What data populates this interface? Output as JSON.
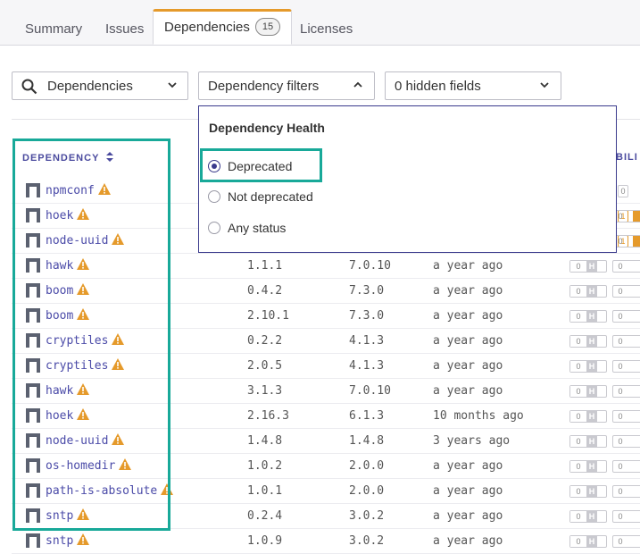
{
  "tabs": [
    {
      "label": "Summary"
    },
    {
      "label": "Issues"
    },
    {
      "label": "Dependencies",
      "count": "15"
    },
    {
      "label": "Licenses"
    }
  ],
  "toolbar": {
    "search_select": "Dependencies",
    "filters_select": "Dependency filters",
    "hidden_fields": "0 hidden fields"
  },
  "table": {
    "dependency_header": "DEPENDENCY",
    "right_header_partial": "BILI",
    "rows": [
      {
        "name": "npmconf",
        "version": "",
        "latest": "",
        "updated": "",
        "vuln": "0",
        "vuln_level": "",
        "vuln_alt": ""
      },
      {
        "name": "hoek",
        "version": "",
        "latest": "",
        "updated": "",
        "vuln": "1",
        "vuln_level": "",
        "vuln_alt": "0"
      },
      {
        "name": "node-uuid",
        "version": "",
        "latest": "",
        "updated": "",
        "vuln": "1",
        "vuln_level": "",
        "vuln_alt": "0"
      },
      {
        "name": "hawk",
        "version": "1.1.1",
        "latest": "7.0.10",
        "updated": "a year ago",
        "vuln": "0",
        "vuln_level": "H",
        "vuln_alt": "0"
      },
      {
        "name": "boom",
        "version": "0.4.2",
        "latest": "7.3.0",
        "updated": "a year ago",
        "vuln": "0",
        "vuln_level": "H",
        "vuln_alt": "0"
      },
      {
        "name": "boom",
        "version": "2.10.1",
        "latest": "7.3.0",
        "updated": "a year ago",
        "vuln": "0",
        "vuln_level": "H",
        "vuln_alt": "0"
      },
      {
        "name": "cryptiles",
        "version": "0.2.2",
        "latest": "4.1.3",
        "updated": "a year ago",
        "vuln": "0",
        "vuln_level": "H",
        "vuln_alt": "0"
      },
      {
        "name": "cryptiles",
        "version": "2.0.5",
        "latest": "4.1.3",
        "updated": "a year ago",
        "vuln": "0",
        "vuln_level": "H",
        "vuln_alt": "0"
      },
      {
        "name": "hawk",
        "version": "3.1.3",
        "latest": "7.0.10",
        "updated": "a year ago",
        "vuln": "0",
        "vuln_level": "H",
        "vuln_alt": "0"
      },
      {
        "name": "hoek",
        "version": "2.16.3",
        "latest": "6.1.3",
        "updated": "10 months ago",
        "vuln": "0",
        "vuln_level": "H",
        "vuln_alt": "0"
      },
      {
        "name": "node-uuid",
        "version": "1.4.8",
        "latest": "1.4.8",
        "updated": "3 years ago",
        "vuln": "0",
        "vuln_level": "H",
        "vuln_alt": "0"
      },
      {
        "name": "os-homedir",
        "version": "1.0.2",
        "latest": "2.0.0",
        "updated": "a year ago",
        "vuln": "0",
        "vuln_level": "H",
        "vuln_alt": "0"
      },
      {
        "name": "path-is-absolute",
        "version": "1.0.1",
        "latest": "2.0.0",
        "updated": "a year ago",
        "vuln": "0",
        "vuln_level": "H",
        "vuln_alt": "0"
      },
      {
        "name": "sntp",
        "version": "0.2.4",
        "latest": "3.0.2",
        "updated": "a year ago",
        "vuln": "0",
        "vuln_level": "H",
        "vuln_alt": "0"
      },
      {
        "name": "sntp",
        "version": "1.0.9",
        "latest": "3.0.2",
        "updated": "a year ago",
        "vuln": "0",
        "vuln_level": "H",
        "vuln_alt": "0"
      }
    ]
  },
  "dropdown": {
    "title": "Dependency Health",
    "options": [
      {
        "label": "Deprecated",
        "selected": true
      },
      {
        "label": "Not deprecated",
        "selected": false
      },
      {
        "label": "Any status",
        "selected": false
      }
    ]
  },
  "colors": {
    "highlight": "#18a999",
    "accent": "#3a3a8c",
    "warning": "#e59a2b",
    "link": "#4b4ba8"
  },
  "icons": [
    "search-icon",
    "chevron-down-icon",
    "chevron-up-icon",
    "sort-icon",
    "package-icon",
    "warning-icon"
  ]
}
